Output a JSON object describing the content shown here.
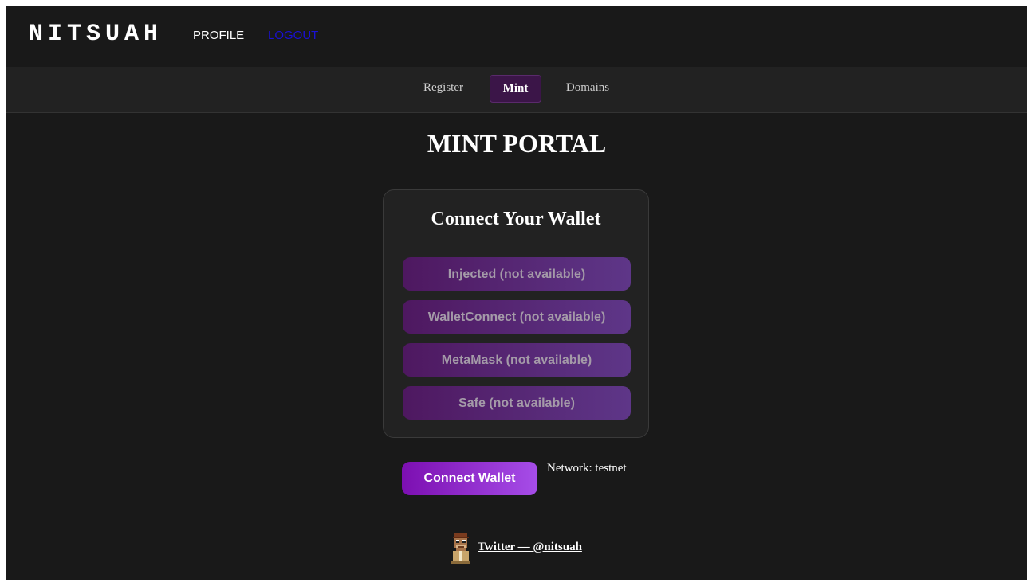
{
  "header": {
    "brand": "NITSUAH",
    "nav": {
      "profile": "PROFILE",
      "logout": "LOGOUT"
    }
  },
  "tabs": [
    {
      "label": "Register",
      "active": false
    },
    {
      "label": "Mint",
      "active": true
    },
    {
      "label": "Domains",
      "active": false
    }
  ],
  "main": {
    "title": "MINT PORTAL",
    "wallet_card": {
      "title": "Connect Your Wallet",
      "options": [
        "Injected (not available)",
        "WalletConnect (not available)",
        "MetaMask (not available)",
        "Safe (not available)"
      ]
    },
    "connect_button": "Connect Wallet",
    "network_label": "Network: testnet"
  },
  "footer": {
    "avatar_icon": "ape-avatar-icon",
    "link": "Twitter — @nitsuah"
  },
  "colors": {
    "background": "#191919",
    "subnav": "#222222",
    "accent": "#7c0fb1",
    "accent_light": "#a64de8",
    "logout_link": "#1a10d6",
    "active_tab": "#3b1548"
  }
}
